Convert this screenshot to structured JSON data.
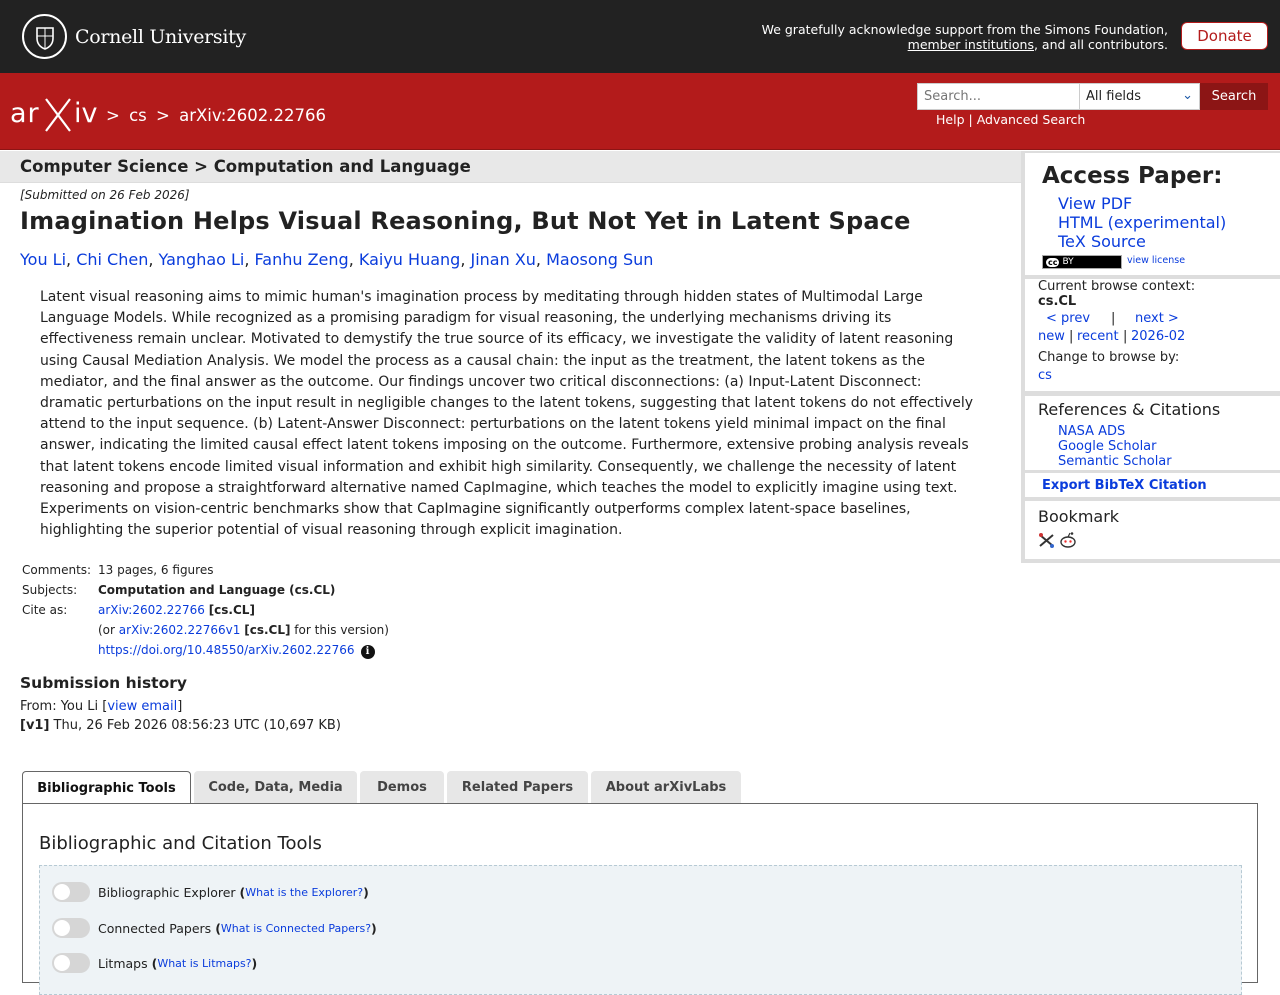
{
  "header": {
    "institution": "Cornell University",
    "ack_line1": "We gratefully acknowledge support from the Simons Foundation,",
    "ack_link": "member institutions",
    "ack_line2_rest": ", and all contributors.",
    "donate_label": "Donate"
  },
  "nav": {
    "logo_text": "arXiv",
    "crumb_sep": ">",
    "crumb_cs": "cs",
    "crumb_id": "arXiv:2602.22766",
    "search_placeholder": "Search...",
    "search_field_selected": "All fields",
    "search_button": "Search",
    "help": "Help",
    "help_sep": "|",
    "advanced": "Advanced Search"
  },
  "paper": {
    "subject_breadcrumb": "Computer Science > Computation and Language",
    "submitted": "[Submitted on 26 Feb 2026]",
    "title": "Imagination Helps Visual Reasoning, But Not Yet in Latent Space",
    "authors": [
      "You Li",
      "Chi Chen",
      "Yanghao Li",
      "Fanhu Zeng",
      "Kaiyu Huang",
      "Jinan Xu",
      "Maosong Sun"
    ],
    "abstract": "Latent visual reasoning aims to mimic human's imagination process by meditating through hidden states of Multimodal Large Language Models. While recognized as a promising paradigm for visual reasoning, the underlying mechanisms driving its effectiveness remain unclear. Motivated to demystify the true source of its efficacy, we investigate the validity of latent reasoning using Causal Mediation Analysis. We model the process as a causal chain: the input as the treatment, the latent tokens as the mediator, and the final answer as the outcome. Our findings uncover two critical disconnections: (a) Input-Latent Disconnect: dramatic perturbations on the input result in negligible changes to the latent tokens, suggesting that latent tokens do not effectively attend to the input sequence. (b) Latent-Answer Disconnect: perturbations on the latent tokens yield minimal impact on the final answer, indicating the limited causal effect latent tokens imposing on the outcome. Furthermore, extensive probing analysis reveals that latent tokens encode limited visual information and exhibit high similarity. Consequently, we challenge the necessity of latent reasoning and propose a straightforward alternative named CapImagine, which teaches the model to explicitly imagine using text. Experiments on vision-centric benchmarks show that CapImagine significantly outperforms complex latent-space baselines, highlighting the superior potential of visual reasoning through explicit imagination."
  },
  "meta": {
    "comments_label": "Comments:",
    "comments": "13 pages, 6 figures",
    "subjects_label": "Subjects:",
    "subjects": "Computation and Language (cs.CL)",
    "cite_label": "Cite as:",
    "cite_id": "arXiv:2602.22766",
    "cite_tag": "[cs.CL]",
    "cite_or": "(or",
    "cite_v1": "arXiv:2602.22766v1",
    "cite_v1_tag": "[cs.CL]",
    "cite_for": "for this version)",
    "doi": "https://doi.org/10.48550/arXiv.2602.22766"
  },
  "history": {
    "title": "Submission history",
    "from": "From: You Li [",
    "email_link": "view email",
    "close": "]",
    "v1_label": "[v1]",
    "v1_text": " Thu, 26 Feb 2026 08:56:23 UTC (10,697 KB)"
  },
  "tabs": [
    {
      "label": "Bibliographic Tools"
    },
    {
      "label": "Code, Data, Media"
    },
    {
      "label": "Demos"
    },
    {
      "label": "Related Papers"
    },
    {
      "label": "About arXivLabs"
    }
  ],
  "panel": {
    "title": "Bibliographic and Citation Tools",
    "tools": [
      {
        "name": "Bibliographic Explorer",
        "help": "What is the Explorer?"
      },
      {
        "name": "Connected Papers",
        "help": "What is Connected Papers?"
      },
      {
        "name": "Litmaps",
        "help": "What is Litmaps?"
      }
    ]
  },
  "sidebar": {
    "access_title": "Access Paper:",
    "links": [
      "View PDF",
      "HTML (experimental)",
      "TeX Source"
    ],
    "cc_label": "BY",
    "view_license": "view license",
    "browse_context_label": "Current browse context:",
    "browse_context": "cs.CL",
    "prev": "< prev",
    "sep": "|",
    "next": "next >",
    "new": "new",
    "recent": "recent",
    "month": "2026-02",
    "change_browse": "Change to browse by:",
    "browse_cs": "cs",
    "refs_title": "References & Citations",
    "refs": [
      "NASA ADS",
      "Google Scholar",
      "Semantic Scholar"
    ],
    "export_bibtex": "Export BibTeX Citation",
    "bookmark_title": "Bookmark"
  }
}
